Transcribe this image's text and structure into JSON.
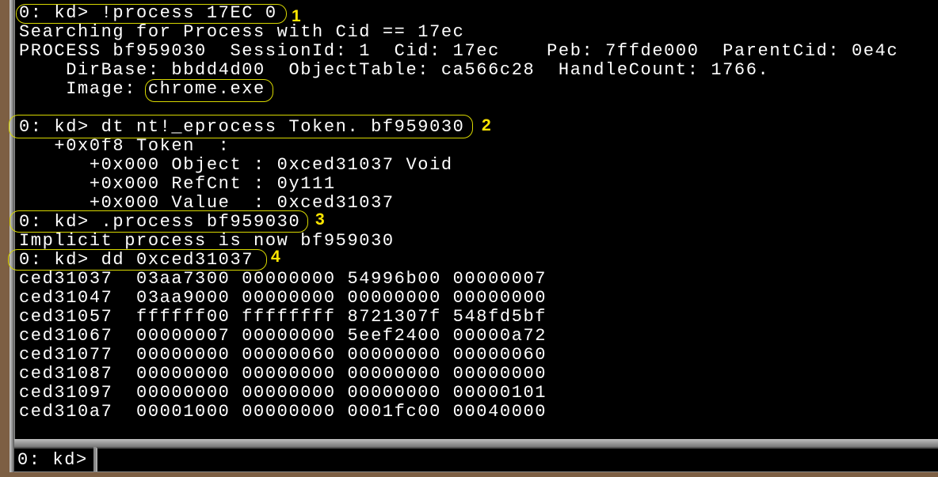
{
  "output_lines": [
    "0: kd> !process 17EC 0",
    "Searching for Process with Cid == 17ec",
    "PROCESS bf959030  SessionId: 1  Cid: 17ec    Peb: 7ffde000  ParentCid: 0e4c",
    "    DirBase: bbdd4d00  ObjectTable: ca566c28  HandleCount: 1766.",
    "    Image: chrome.exe",
    "",
    "0: kd> dt nt!_eprocess Token. bf959030",
    "   +0x0f8 Token  :",
    "      +0x000 Object : 0xced31037 Void",
    "      +0x000 RefCnt : 0y111",
    "      +0x000 Value  : 0xced31037",
    "0: kd> .process bf959030",
    "Implicit process is now bf959030",
    "0: kd> dd 0xced31037",
    "ced31037  03aa7300 00000000 54996b00 00000007",
    "ced31047  03aa9000 00000000 00000000 00000000",
    "ced31057  ffffff00 ffffffff 8721307f 548fd5bf",
    "ced31067  00000007 00000000 5eef2400 00000a72",
    "ced31077  00000000 00000060 00000000 00000060",
    "ced31087  00000000 00000000 00000000 00000000",
    "ced31097  00000000 00000000 00000000 00000101",
    "ced310a7  00001000 00000000 0001fc00 00040000"
  ],
  "annotations": [
    "1",
    "2",
    "3",
    "4"
  ],
  "command_bar": {
    "prompt": "0: kd>",
    "input_value": ""
  },
  "colors": {
    "annotation": "#ffe600",
    "background": "#000000",
    "text": "#ffffff"
  }
}
